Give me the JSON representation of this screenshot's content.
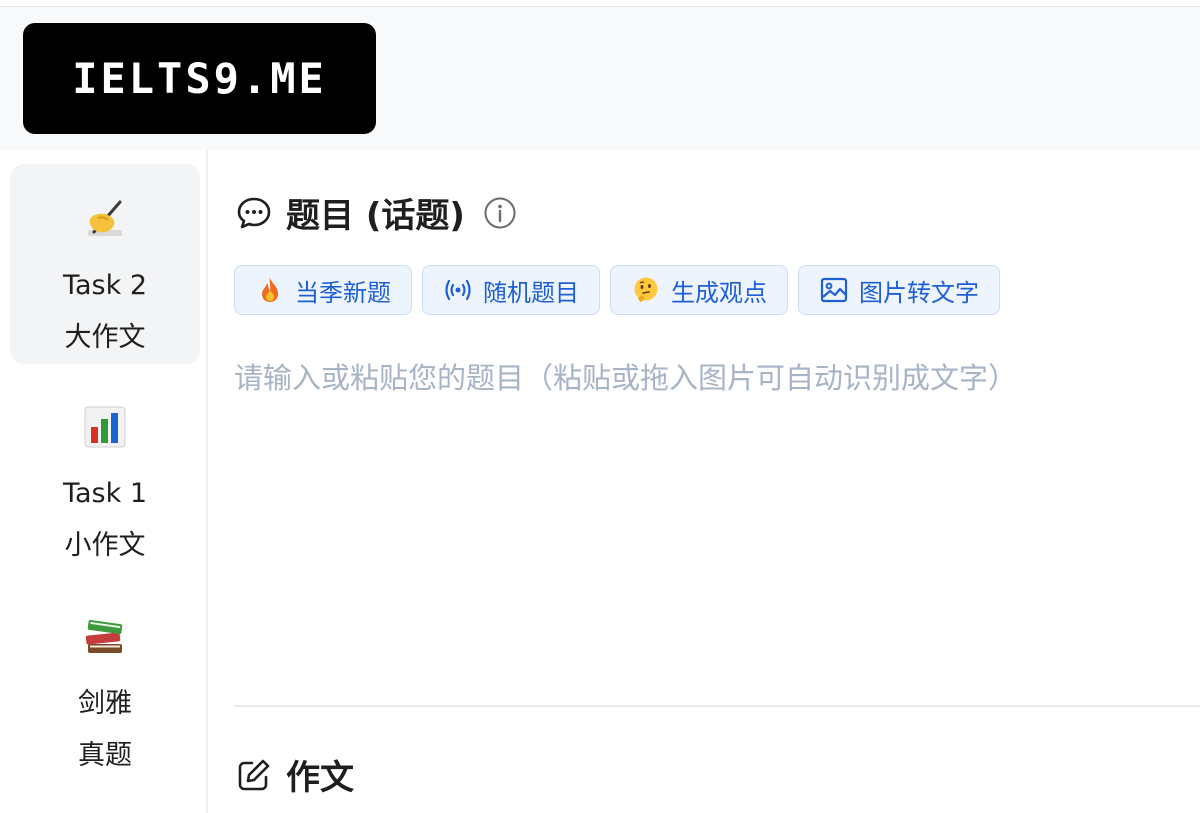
{
  "brand": {
    "logo_text": "IELTS9.ME"
  },
  "sidebar": {
    "items": [
      {
        "icon": "writing-hand-icon",
        "line1": "Task 2",
        "line2": "大作文",
        "active": true
      },
      {
        "icon": "bar-chart-icon",
        "line1": "Task 1",
        "line2": "小作文",
        "active": false
      },
      {
        "icon": "books-icon",
        "line1": "剑雅",
        "line2": "真题",
        "active": false
      }
    ]
  },
  "topic": {
    "title": "题目 (话题)",
    "input_placeholder": "请输入或粘贴您的题目（粘贴或拖入图片可自动识别成文字）",
    "input_value": "",
    "buttons": [
      {
        "icon": "fire-icon",
        "label": "当季新题"
      },
      {
        "icon": "radio-waves-icon",
        "label": "随机题目"
      },
      {
        "icon": "thinking-face-icon",
        "label": "生成观点"
      },
      {
        "icon": "image-icon",
        "label": "图片转文字"
      }
    ]
  },
  "essay": {
    "title": "作文"
  },
  "colors": {
    "button_text": "#1f5fd6",
    "button_bg": "#eef4fd",
    "button_border": "#c8dcf7",
    "placeholder": "#a7b3c6",
    "logo_bg": "#000000"
  }
}
